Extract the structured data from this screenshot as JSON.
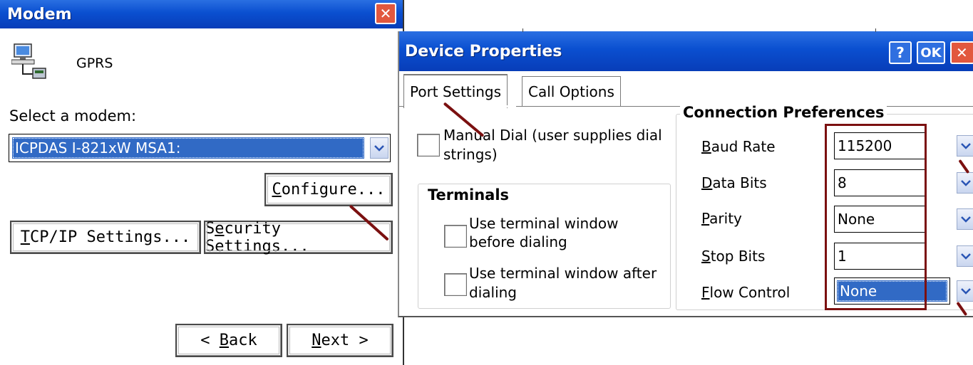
{
  "modem_window": {
    "title": "Modem",
    "connection_name": "GPRS",
    "select_label": "Select a modem:",
    "selected_modem": "ICPDAS I-821xW MSA1:",
    "configure_label": "Configure...",
    "configure_ul": "C",
    "configure_rest": "onfigure...",
    "tcpip_ul": "T",
    "tcpip_rest": "CP/IP Settings...",
    "security_pre": "S",
    "security_ul": "e",
    "security_rest": "curity Settings...",
    "back_pre": "< ",
    "back_ul": "B",
    "back_rest": "ack",
    "next_ul": "N",
    "next_rest": "ext >"
  },
  "device_properties": {
    "title": "Device Properties",
    "help_label": "?",
    "ok_label": "OK",
    "tabs": [
      {
        "label": "Port Settings",
        "active": true
      },
      {
        "label": "Call Options",
        "active": false
      }
    ],
    "manual_dial_line1": "Manual Dial (user supplies dial",
    "manual_dial_line2": "strings)",
    "terminals_title": "Terminals",
    "term_before_line1": "Use terminal window",
    "term_before_line2": "before dialing",
    "term_after_line1": "Use terminal window after",
    "term_after_line2": "dialing",
    "connection_title": "Connection Preferences",
    "fields": [
      {
        "label": "Baud Rate",
        "value": "115200"
      },
      {
        "label": "Data Bits",
        "value": "8"
      },
      {
        "label": "Parity",
        "value": "None"
      },
      {
        "label": "Stop Bits",
        "value": "1"
      },
      {
        "label": "Flow Control",
        "value": "None"
      }
    ]
  },
  "colors": {
    "titlebar": "#0a4fd0",
    "close_button": "#e2583e",
    "selection": "#316ac5",
    "annotation": "#7b1010"
  }
}
